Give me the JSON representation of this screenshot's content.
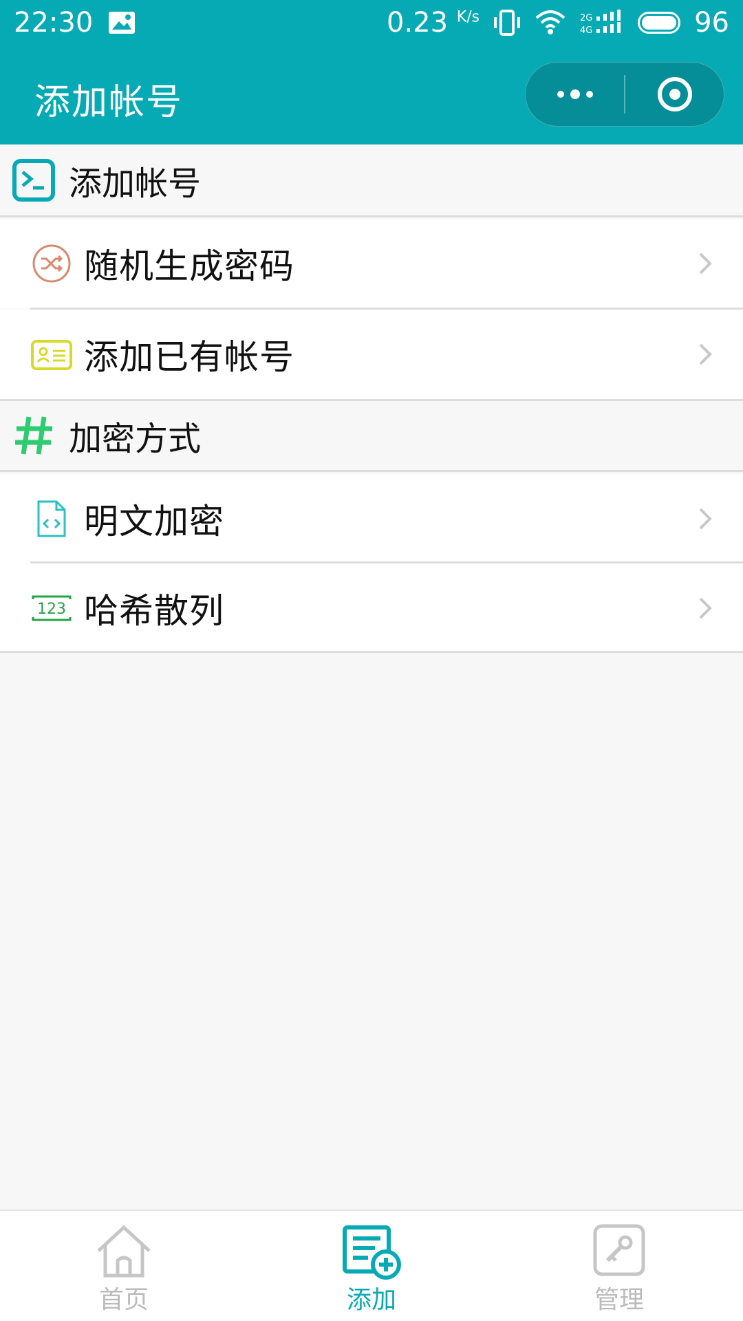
{
  "status_bar": {
    "time": "22:30",
    "net_speed": "0.23",
    "net_unit": "K/s",
    "network": "2G 4G",
    "battery": "96"
  },
  "nav": {
    "title": "添加帐号",
    "menu_icon": "more-dots-icon",
    "close_icon": "target-circle-icon"
  },
  "sections": [
    {
      "header": "添加帐号",
      "icon": "terminal-icon",
      "items": [
        {
          "label": "随机生成密码",
          "icon": "shuffle-icon"
        },
        {
          "label": "添加已有帐号",
          "icon": "id-card-icon"
        }
      ]
    },
    {
      "header": "加密方式",
      "icon": "hash-icon",
      "items": [
        {
          "label": "明文加密",
          "icon": "code-file-icon"
        },
        {
          "label": "哈希散列",
          "icon": "numbers-icon"
        }
      ]
    }
  ],
  "tabs": [
    {
      "label": "首页",
      "icon": "home-icon",
      "active": false
    },
    {
      "label": "添加",
      "icon": "add-list-icon",
      "active": true
    },
    {
      "label": "管理",
      "icon": "key-icon",
      "active": false
    }
  ],
  "colors": {
    "primary": "#06aab5",
    "shuffle": "#d9886b",
    "idcard": "#d9d92a",
    "hash": "#2ecc71",
    "code": "#2cc0c6",
    "numbers": "#27a04a",
    "inactive": "#bbbbbb"
  }
}
